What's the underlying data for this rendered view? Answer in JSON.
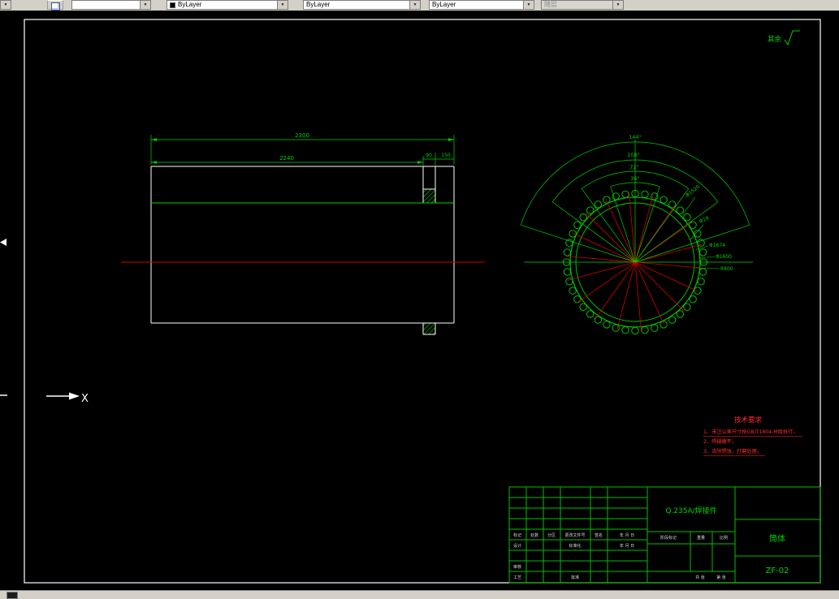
{
  "icons": {
    "dropdown_arrow": "▼"
  },
  "toolbar": {
    "color_value": "ByLayer",
    "linetype_value": "ByLayer",
    "lineweight_value": "ByLayer",
    "plotstyle_value": "随层"
  },
  "drawing": {
    "surface_note": "其余",
    "ucs_x": "X",
    "side_view": {
      "dim_2300": "2300",
      "dim_2240": "2240",
      "dim_90": "90",
      "dim_150": "150"
    },
    "end_view": {
      "angle_144": "144°",
      "angle_108": "108°",
      "angle_72": "72°",
      "angle_36": "36°",
      "dia_1": "Φ1520",
      "dia_2": "Φ19",
      "dia_3": "Φ1674",
      "dia_4": "Φ1600",
      "dia_5": "R800"
    },
    "tech_req": {
      "title": "技术要求",
      "item_1": "1、未注公差尺寸按GB/T1804-M级执行。",
      "item_2": "2、焊缝磨平。",
      "item_3": "3、去除锈蚀，打磨处理。"
    },
    "title_block": {
      "material": "Q.235A/焊接件",
      "part_name": "筒体",
      "drawing_no": "ZF-02",
      "mark": "标记",
      "count": "处数",
      "zone": "分区",
      "change_doc": "更改文件号",
      "signature": "签名",
      "date": "年 月 日",
      "design": "设计",
      "standardization": "标准化",
      "audit": "审核",
      "process": "工艺",
      "approve": "批准",
      "stage_mark": "阶段标记",
      "weight": "重量",
      "scale": "比例",
      "total_sheets": "共 张",
      "sheet_no": "第 张",
      "date2": "年 月 日"
    }
  }
}
